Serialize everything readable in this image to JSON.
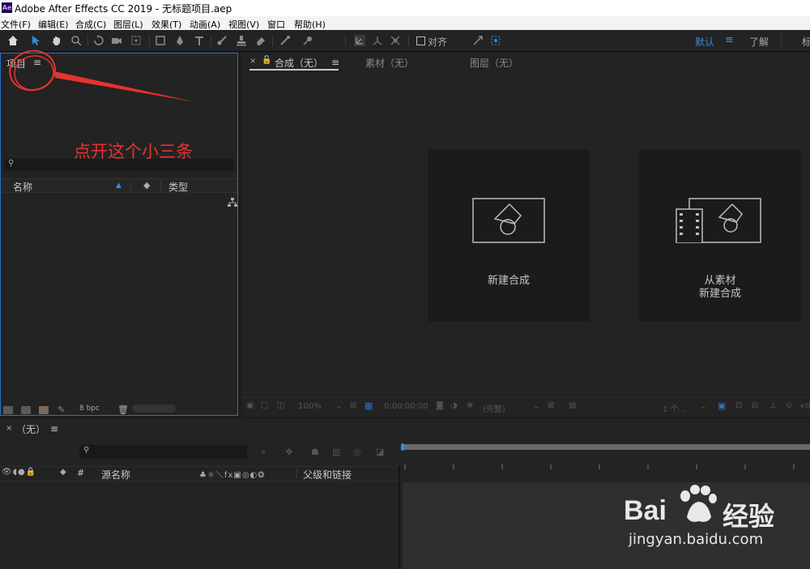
{
  "window": {
    "logo": "Ae",
    "title": "Adobe After Effects CC 2019 - 无标题项目.aep"
  },
  "menu": [
    "文件(F)",
    "编辑(E)",
    "合成(C)",
    "图层(L)",
    "效果(T)",
    "动画(A)",
    "视图(V)",
    "窗口",
    "帮助(H)"
  ],
  "toolbar": {
    "snap_label": "对齐",
    "workspace_default": "默认",
    "workspace_menu": "≡",
    "workspace_learn": "了解",
    "workspace_more": "标"
  },
  "project_panel": {
    "title": "项目",
    "menu_icon": "≡",
    "columns": {
      "name": "名称",
      "type": "类型"
    },
    "bit_depth": "8 bpc",
    "annotation": "点开这个小三条"
  },
  "comp_panel": {
    "close_glyph": "×",
    "tab_comp": "合成（无）",
    "tab_comp_menu": "≡",
    "tab_footage": "素材（无）",
    "tab_layer": "图层（无）",
    "card_new_comp": "新建合成",
    "card_from_footage_line1": "从素材",
    "card_from_footage_line2": "新建合成",
    "footer": {
      "zoom": "100%",
      "timecode": "0:00:00:00",
      "resolution": "(完整)",
      "view_count": "1 个...",
      "offset": "+0"
    }
  },
  "timeline": {
    "close_glyph": "×",
    "tab_label": "（无）",
    "tab_menu": "≡",
    "col_hash": "#",
    "col_source": "源名称",
    "col_parent": "父级和链接"
  },
  "watermark": {
    "brand": "Bai",
    "brand2": "经验",
    "url": "jingyan.baidu.com"
  },
  "colors": {
    "accent": "#2d8ceb",
    "annotation": "#e8322e",
    "panel": "#232323"
  }
}
